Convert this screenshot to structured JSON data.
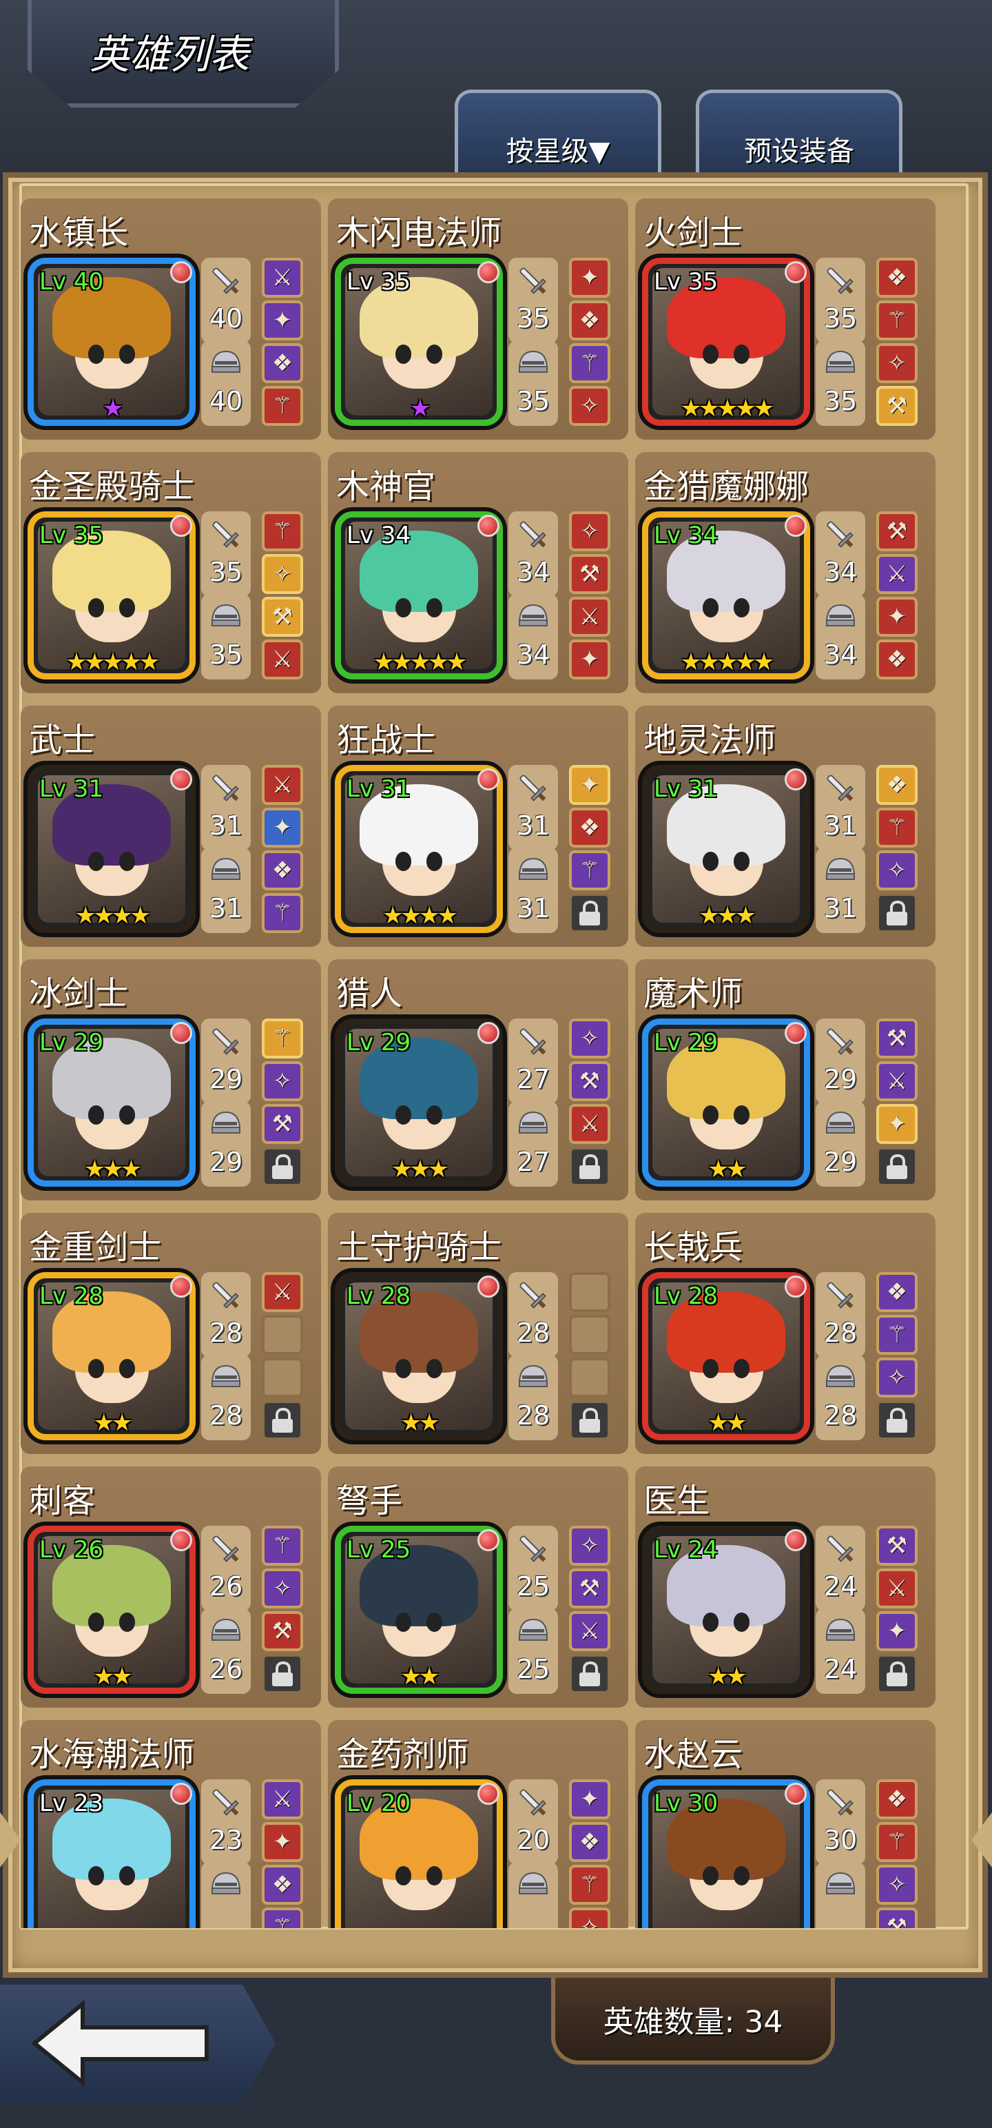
{
  "header": {
    "title": "英雄列表"
  },
  "tabs": {
    "sort_label": "按星级▼",
    "preset_label": "预设装备"
  },
  "footer": {
    "hero_count_label": "英雄数量: 34"
  },
  "colors": {
    "panel": "#bfa16f",
    "card": "#9c7c56",
    "level_green": "#5cff3a",
    "star_gold": "#ffd21a",
    "star_purple": "#c23cff"
  },
  "heroes": [
    {
      "name": "水镇长",
      "level": "Lv 40",
      "weapon": "40",
      "armor": "40",
      "stars": 1,
      "star_color": "purple",
      "frame": "blue",
      "lv_color": "green",
      "hair": "#c8821e",
      "slots": [
        "purple",
        "purple",
        "purple",
        "red"
      ]
    },
    {
      "name": "木闪电法师",
      "level": "Lv 35",
      "weapon": "35",
      "armor": "35",
      "stars": 1,
      "star_color": "purple",
      "frame": "green",
      "lv_color": "white",
      "hair": "#f0dc9a",
      "slots": [
        "red",
        "red",
        "purple",
        "red"
      ]
    },
    {
      "name": "火剑士",
      "level": "Lv 35",
      "weapon": "35",
      "armor": "35",
      "stars": 5,
      "star_color": "gold",
      "frame": "red",
      "lv_color": "white",
      "hair": "#e0302a",
      "slots": [
        "red",
        "red",
        "red",
        "gold"
      ]
    },
    {
      "name": "金圣殿骑士",
      "level": "Lv 35",
      "weapon": "35",
      "armor": "35",
      "stars": 5,
      "star_color": "gold",
      "frame": "gold",
      "lv_color": "green",
      "hair": "#f2dc8a",
      "slots": [
        "red",
        "gold",
        "gold",
        "red"
      ]
    },
    {
      "name": "木神官",
      "level": "Lv 34",
      "weapon": "34",
      "armor": "34",
      "stars": 5,
      "star_color": "gold",
      "frame": "green",
      "lv_color": "white",
      "hair": "#4ec8a0",
      "slots": [
        "red",
        "red",
        "red",
        "red"
      ]
    },
    {
      "name": "金猎魔娜娜",
      "level": "Lv 34",
      "weapon": "34",
      "armor": "34",
      "stars": 5,
      "star_color": "gold",
      "frame": "gold",
      "lv_color": "green",
      "hair": "#d8d4e0",
      "slots": [
        "red",
        "purple",
        "red",
        "red"
      ]
    },
    {
      "name": "武士",
      "level": "Lv 31",
      "weapon": "31",
      "armor": "31",
      "stars": 4,
      "star_color": "gold",
      "frame": "dark",
      "lv_color": "green",
      "hair": "#4a2a6a",
      "slots": [
        "red",
        "blue",
        "purple",
        "purple"
      ]
    },
    {
      "name": "狂战士",
      "level": "Lv 31",
      "weapon": "31",
      "armor": "31",
      "stars": 4,
      "star_color": "gold",
      "frame": "gold",
      "lv_color": "green",
      "hair": "#f4f4f4",
      "slots": [
        "gold",
        "red",
        "purple",
        "locked"
      ]
    },
    {
      "name": "地灵法师",
      "level": "Lv 31",
      "weapon": "31",
      "armor": "31",
      "stars": 3,
      "star_color": "gold",
      "frame": "dark",
      "lv_color": "green",
      "hair": "#e8e8e8",
      "slots": [
        "gold",
        "red",
        "purple",
        "locked"
      ]
    },
    {
      "name": "冰剑士",
      "level": "Lv 29",
      "weapon": "29",
      "armor": "29",
      "stars": 3,
      "star_color": "gold",
      "frame": "blue",
      "lv_color": "green",
      "hair": "#c8c8cc",
      "slots": [
        "gold",
        "purple",
        "purple",
        "locked"
      ]
    },
    {
      "name": "猎人",
      "level": "Lv 29",
      "weapon": "27",
      "armor": "27",
      "stars": 3,
      "star_color": "gold",
      "frame": "dark",
      "lv_color": "green",
      "hair": "#2a6a8a",
      "slots": [
        "purple",
        "purple",
        "red",
        "locked"
      ]
    },
    {
      "name": "魔术师",
      "level": "Lv 29",
      "weapon": "29",
      "armor": "29",
      "stars": 2,
      "star_color": "gold",
      "frame": "blue",
      "lv_color": "green",
      "hair": "#e8c050",
      "slots": [
        "purple",
        "purple",
        "gold",
        "locked"
      ]
    },
    {
      "name": "金重剑士",
      "level": "Lv 28",
      "weapon": "28",
      "armor": "28",
      "stars": 2,
      "star_color": "gold",
      "frame": "gold",
      "lv_color": "green",
      "hair": "#f0b050",
      "slots": [
        "red",
        "empty",
        "empty",
        "locked"
      ]
    },
    {
      "name": "土守护骑士",
      "level": "Lv 28",
      "weapon": "28",
      "armor": "28",
      "stars": 2,
      "star_color": "gold",
      "frame": "dark",
      "lv_color": "green",
      "hair": "#8a5030",
      "slots": [
        "empty",
        "empty",
        "empty",
        "locked"
      ]
    },
    {
      "name": "长戟兵",
      "level": "Lv 28",
      "weapon": "28",
      "armor": "28",
      "stars": 2,
      "star_color": "gold",
      "frame": "red",
      "lv_color": "green",
      "hair": "#d83a20",
      "slots": [
        "purple",
        "purple",
        "purple",
        "locked"
      ]
    },
    {
      "name": "刺客",
      "level": "Lv 26",
      "weapon": "26",
      "armor": "26",
      "stars": 2,
      "star_color": "gold",
      "frame": "red",
      "lv_color": "green",
      "hair": "#a8c060",
      "slots": [
        "purple",
        "purple",
        "red",
        "locked"
      ]
    },
    {
      "name": "弩手",
      "level": "Lv 25",
      "weapon": "25",
      "armor": "25",
      "stars": 2,
      "star_color": "gold",
      "frame": "green",
      "lv_color": "green",
      "hair": "#2a3a4a",
      "slots": [
        "purple",
        "purple",
        "purple",
        "locked"
      ]
    },
    {
      "name": "医生",
      "level": "Lv 24",
      "weapon": "24",
      "armor": "24",
      "stars": 2,
      "star_color": "gold",
      "frame": "dark",
      "lv_color": "green",
      "hair": "#c8c4d8",
      "slots": [
        "purple",
        "red",
        "purple",
        "locked"
      ]
    },
    {
      "name": "水海潮法师",
      "level": "Lv 23",
      "weapon": "23",
      "armor": "",
      "stars": 0,
      "star_color": "gold",
      "frame": "blue",
      "lv_color": "white",
      "hair": "#80d8e8",
      "slots": [
        "purple",
        "red",
        "purple",
        "purple"
      ]
    },
    {
      "name": "金药剂师",
      "level": "Lv 20",
      "weapon": "20",
      "armor": "",
      "stars": 0,
      "star_color": "gold",
      "frame": "gold",
      "lv_color": "green",
      "hair": "#f0a030",
      "slots": [
        "purple",
        "purple",
        "red",
        "red"
      ]
    },
    {
      "name": "水赵云",
      "level": "Lv 30",
      "weapon": "30",
      "armor": "",
      "stars": 0,
      "star_color": "gold",
      "frame": "blue",
      "lv_color": "green",
      "hair": "#8a4a20",
      "slots": [
        "red",
        "red",
        "purple",
        "purple"
      ]
    }
  ]
}
